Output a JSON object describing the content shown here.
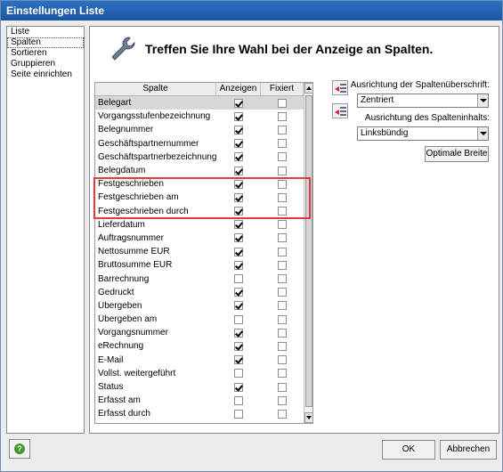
{
  "window": {
    "title": "Einstellungen Liste"
  },
  "nav": {
    "items": [
      {
        "label": "Liste",
        "selected": false
      },
      {
        "label": "Spalten",
        "selected": true
      },
      {
        "label": "Sortieren",
        "selected": false
      },
      {
        "label": "Gruppieren",
        "selected": false
      },
      {
        "label": "Seite einrichten",
        "selected": false
      }
    ]
  },
  "main": {
    "heading": "Treffen Sie Ihre Wahl bei der Anzeige an Spalten."
  },
  "grid": {
    "headers": {
      "name": "Spalte",
      "show": "Anzeigen",
      "fixed": "Fixiert"
    },
    "rows": [
      {
        "name": "Belegart",
        "show": true,
        "fixed": false,
        "selected": true
      },
      {
        "name": "Vorgangsstufenbezeichnung",
        "show": true,
        "fixed": false
      },
      {
        "name": "Belegnummer",
        "show": true,
        "fixed": false
      },
      {
        "name": "Geschäftspartnernummer",
        "show": true,
        "fixed": false
      },
      {
        "name": "Geschäftspartnerbezeichnung",
        "show": true,
        "fixed": false
      },
      {
        "name": "Belegdatum",
        "show": true,
        "fixed": false
      },
      {
        "name": "Festgeschrieben",
        "show": true,
        "fixed": false
      },
      {
        "name": "Festgeschrieben am",
        "show": true,
        "fixed": false
      },
      {
        "name": "Festgeschrieben durch",
        "show": true,
        "fixed": false
      },
      {
        "name": "Lieferdatum",
        "show": true,
        "fixed": false
      },
      {
        "name": "Auftragsnummer",
        "show": true,
        "fixed": false
      },
      {
        "name": "Nettosumme EUR",
        "show": true,
        "fixed": false
      },
      {
        "name": "Bruttosumme EUR",
        "show": true,
        "fixed": false
      },
      {
        "name": "Barrechnung",
        "show": false,
        "fixed": false
      },
      {
        "name": "Gedruckt",
        "show": true,
        "fixed": false
      },
      {
        "name": "Übergeben",
        "show": true,
        "fixed": false
      },
      {
        "name": "Übergeben am",
        "show": false,
        "fixed": false
      },
      {
        "name": "Vorgangsnummer",
        "show": true,
        "fixed": false
      },
      {
        "name": "eRechnung",
        "show": true,
        "fixed": false
      },
      {
        "name": "E-Mail",
        "show": true,
        "fixed": false
      },
      {
        "name": "Vollst. weitergeführt",
        "show": false,
        "fixed": false
      },
      {
        "name": "Status",
        "show": true,
        "fixed": false
      },
      {
        "name": "Erfasst am",
        "show": false,
        "fixed": false
      },
      {
        "name": "Erfasst durch",
        "show": false,
        "fixed": false
      }
    ]
  },
  "settings": {
    "header_align_label": "Ausrichtung der Spaltenüberschrift:",
    "header_align_value": "Zentriert",
    "content_align_label": "Ausrichtung des Spalteninhalts:",
    "content_align_value": "Linksbündig",
    "optimal_width_button": "Optimale Breite"
  },
  "footer": {
    "ok": "OK",
    "cancel": "Abbrechen"
  },
  "colors": {
    "highlight": "#e23b3b",
    "titlebar": "#1c56a5",
    "help": "#3f9a2e"
  }
}
